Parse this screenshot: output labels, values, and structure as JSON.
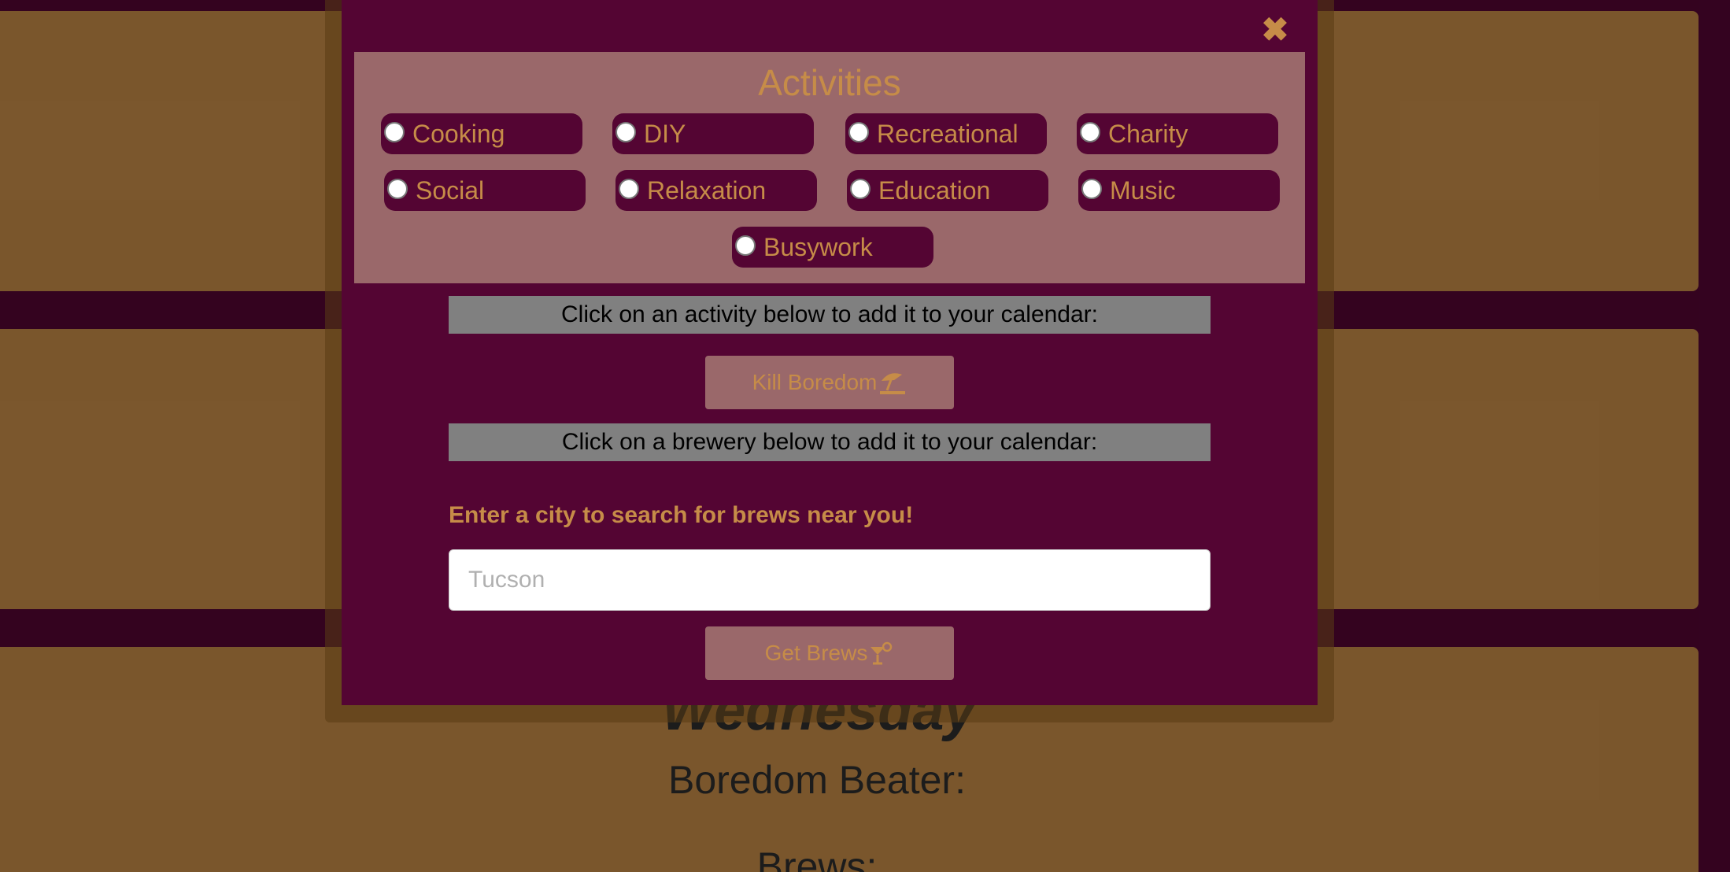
{
  "background": {
    "day_title": "Wednesday",
    "boredom_label": "Boredom Beater:",
    "brews_label": "Brews:"
  },
  "modal": {
    "close_icon": "✖",
    "activities_title": "Activities",
    "activities": [
      "Cooking",
      "DIY",
      "Recreational",
      "Charity",
      "Social",
      "Relaxation",
      "Education",
      "Music",
      "Busywork"
    ],
    "activity_banner": "Click on an activity below to add it to your calendar:",
    "kill_boredom_label": "Kill Boredom",
    "brewery_banner": "Click on a brewery below to add it to your calendar:",
    "search_label": "Enter a city to search for brews near you!",
    "city_placeholder": "Tucson",
    "get_brews_label": "Get Brews"
  },
  "colors": {
    "primary": "#540533",
    "accent": "#c68c48",
    "panel": "#9a686a",
    "banner": "#808080"
  },
  "icons": {
    "kill_boredom": "umbrella-beach-icon",
    "get_brews": "cocktail-glass-icon",
    "close": "close-icon"
  }
}
